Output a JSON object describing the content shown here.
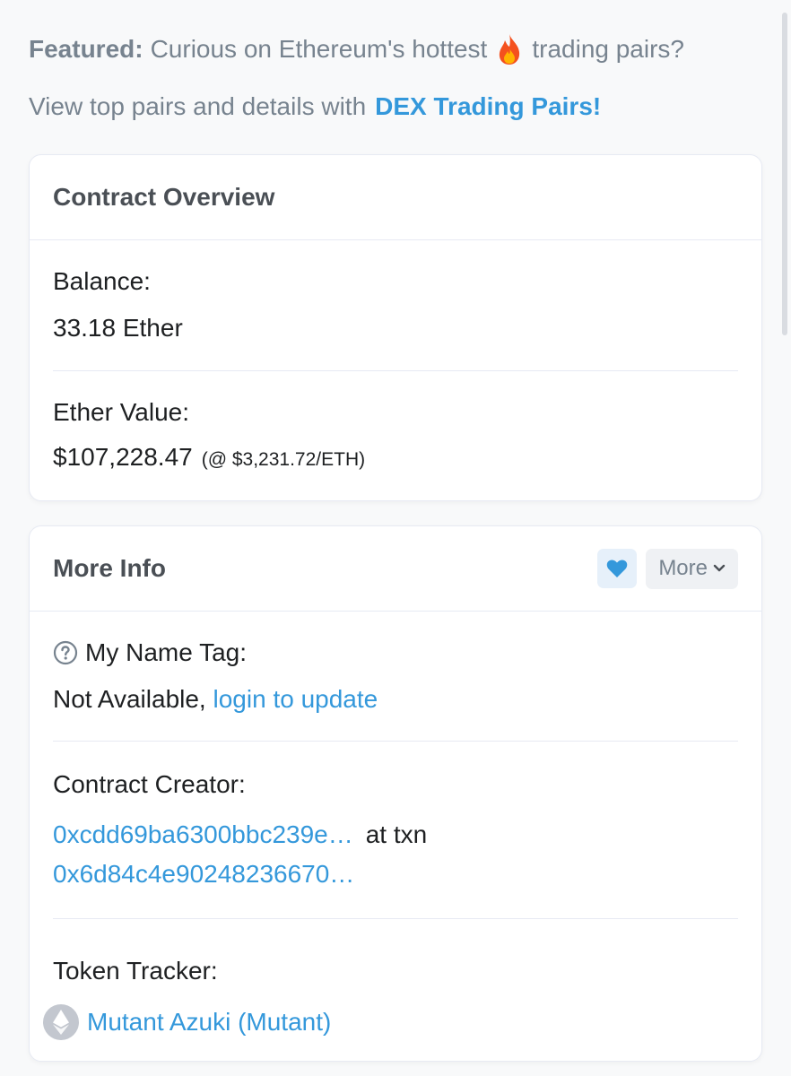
{
  "featured": {
    "label": "Featured:",
    "text_before": "Curious on Ethereum's hottest",
    "emoji": "🔥",
    "text_after": "trading pairs?",
    "line2_text": "View top pairs and details with",
    "line2_link": "DEX Trading Pairs!"
  },
  "overview": {
    "title": "Contract Overview",
    "balance_label": "Balance:",
    "balance_value": "33.18 Ether",
    "ether_value_label": "Ether Value:",
    "ether_value": "$107,228.47",
    "eth_rate": "(@ $3,231.72/ETH)"
  },
  "more_info": {
    "title": "More Info",
    "more_button": "More",
    "name_tag_label": "My Name Tag:",
    "name_tag_value": "Not Available,",
    "name_tag_link": "login to update",
    "creator_label": "Contract Creator:",
    "creator_address": "0xcdd69ba6300bbc239e…",
    "creator_at_txn": "at txn",
    "creator_txn": "0x6d84c4e90248236670…",
    "token_tracker_label": "Token Tracker:",
    "token_tracker_value": "Mutant Azuki (Mutant)"
  },
  "colors": {
    "link": "#3498db",
    "muted": "#77838f",
    "border": "#e7eaf3"
  },
  "icons": {
    "fire": "fire-icon",
    "heart": "heart-icon",
    "chevron": "chevron-down-icon",
    "help": "question-circle-icon",
    "token": "ethereum-icon"
  }
}
